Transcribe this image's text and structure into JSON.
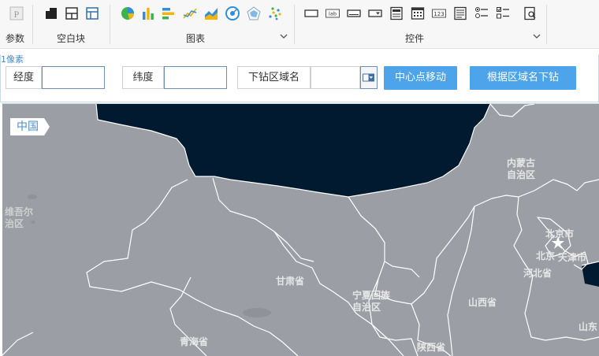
{
  "ribbon": {
    "groups": [
      {
        "label": "参数"
      },
      {
        "label": "空白块"
      },
      {
        "label": "图表"
      },
      {
        "label": "控件"
      }
    ],
    "colors": {
      "accent": "#2f8fdc",
      "bar_yellow": "#f2b40c",
      "bar_green": "#3bb54a"
    }
  },
  "form": {
    "pixel_label": "1像素",
    "longitude_label": "经度",
    "longitude_value": "",
    "latitude_label": "纬度",
    "latitude_value": "",
    "drill_label": "下钻区域名",
    "drill_value": "",
    "center_button": "中心点移动",
    "drill_button": "根据区域名下钻"
  },
  "map": {
    "breadcrumb": "中国",
    "colors": {
      "land": "#9b9fa5",
      "highlight": "#021a30",
      "border": "#ffffff"
    },
    "labels": [
      {
        "id": "xinjiang",
        "text": "维吾尔\n治区"
      },
      {
        "id": "neimenggu",
        "text": "内蒙古\n自治区"
      },
      {
        "id": "beijing",
        "text": "北京市"
      },
      {
        "id": "beijing2",
        "text": "北京"
      },
      {
        "id": "tianjin",
        "text": "天津市"
      },
      {
        "id": "hebei",
        "text": "河北省"
      },
      {
        "id": "gansu",
        "text": "甘肃省"
      },
      {
        "id": "ningxia",
        "text": "宁夏回族\n自治区"
      },
      {
        "id": "shanxi",
        "text": "山西省"
      },
      {
        "id": "qinghai",
        "text": "青海省"
      },
      {
        "id": "shaanxi",
        "text": "陕西省"
      },
      {
        "id": "shandong",
        "text": "山东"
      }
    ]
  }
}
